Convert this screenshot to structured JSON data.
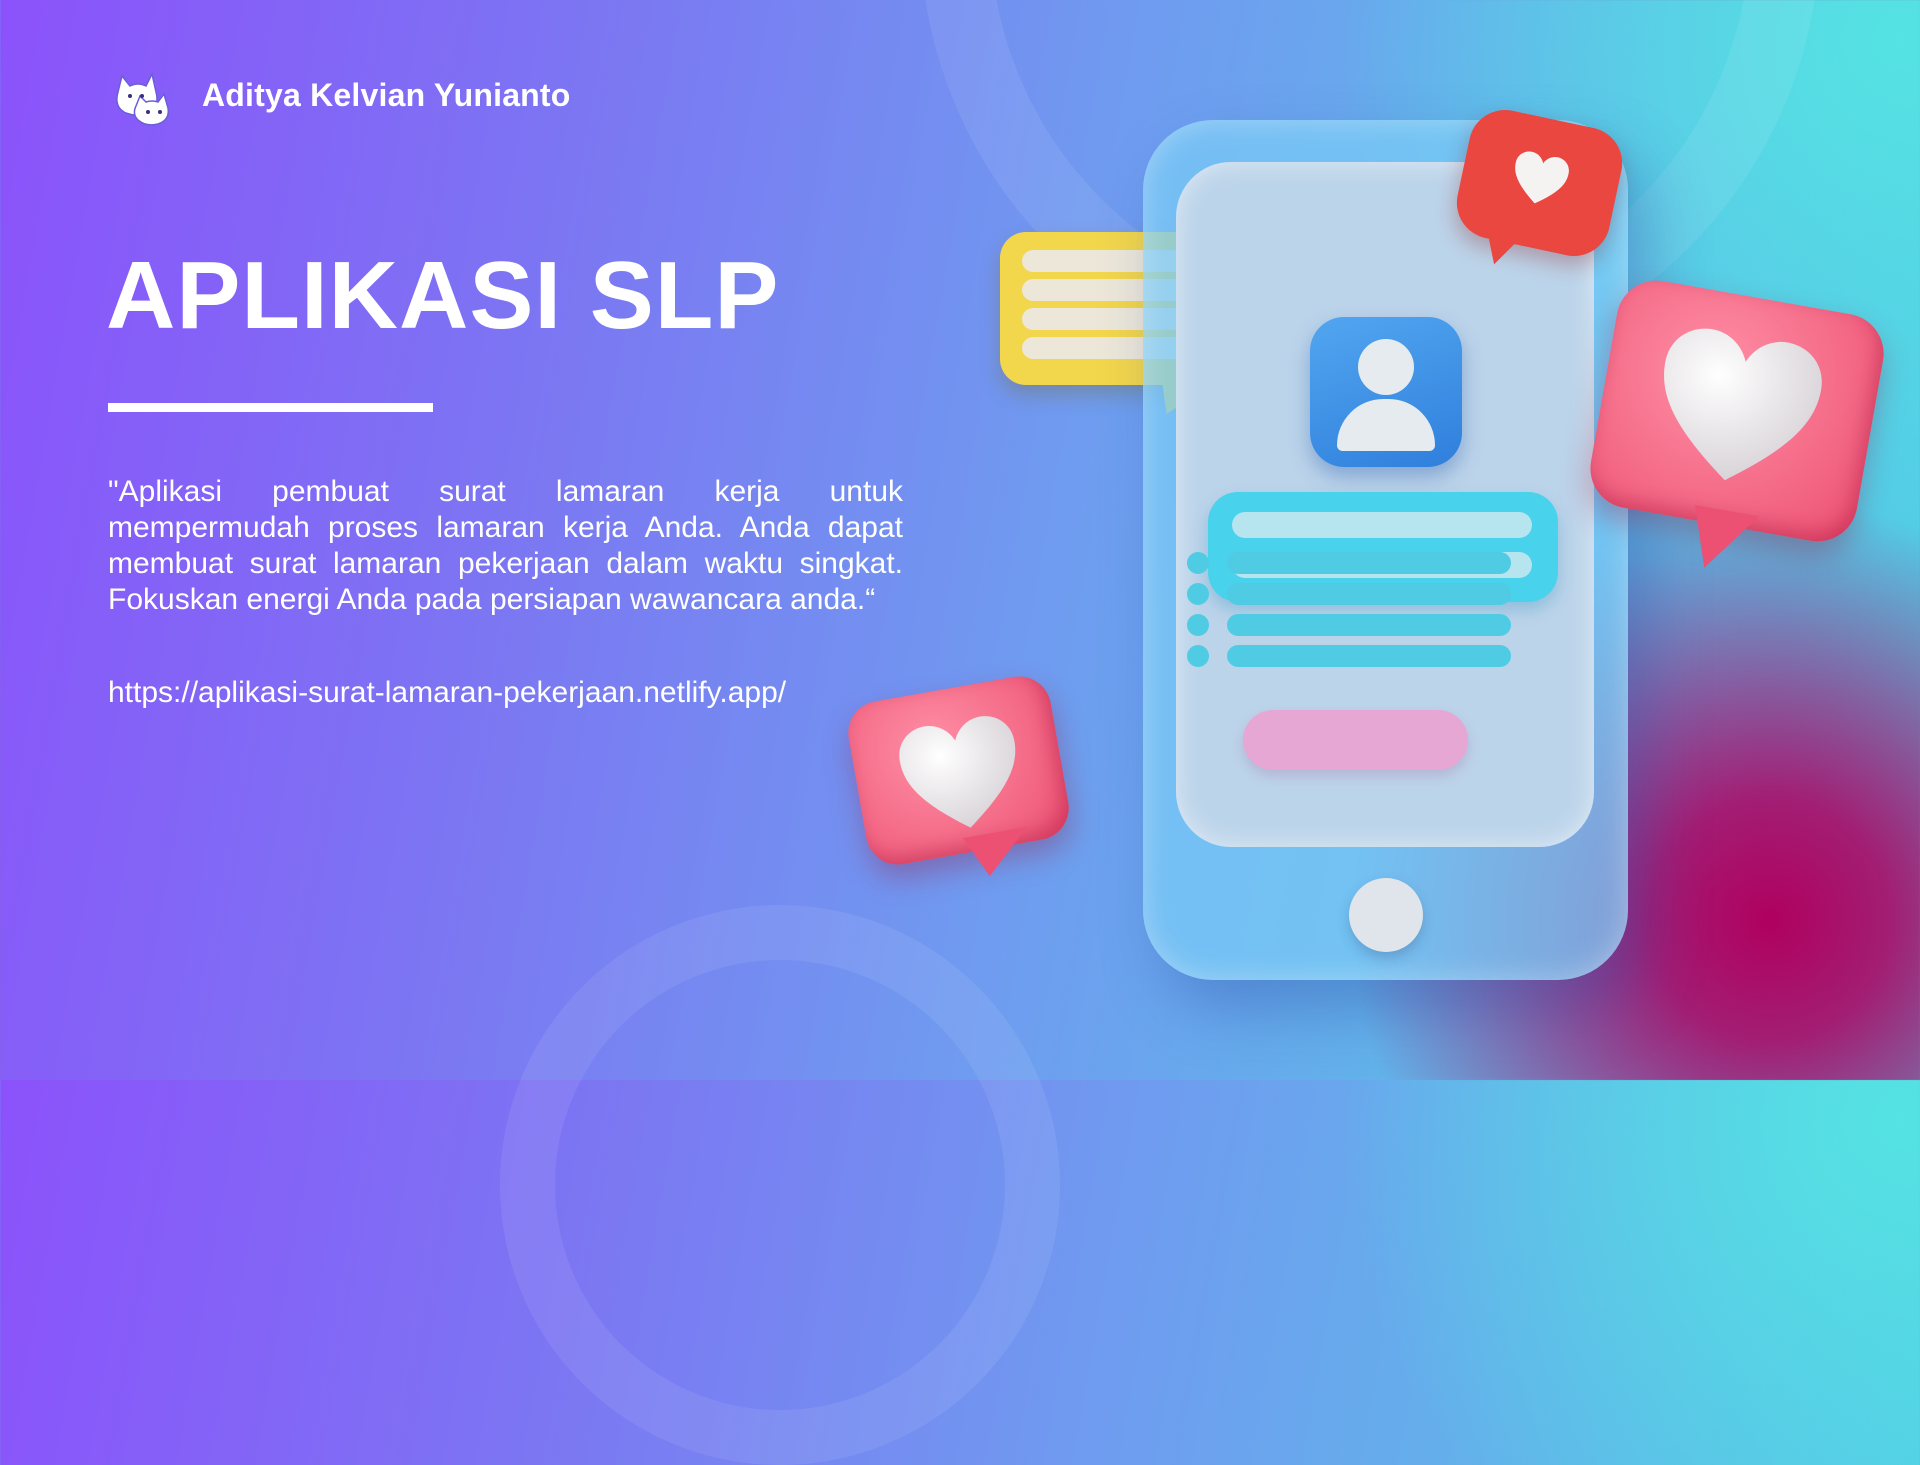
{
  "header": {
    "author_name": "Aditya Kelvian Yunianto",
    "logo_icon": "cat-mascot-logo"
  },
  "main": {
    "title": "APLIKASI SLP",
    "description": "\"Aplikasi pembuat surat lamaran kerja untuk mempermudah proses lamaran kerja Anda. Anda dapat membuat surat lamaran pekerjaan dalam waktu singkat. Fokuskan energi Anda pada persiapan wawancara anda.“",
    "url": "https://aplikasi-surat-lamaran-pekerjaan.netlify.app/"
  },
  "illustration": {
    "type": "phone-with-chat-bubbles-and-hearts",
    "icons": [
      "user-icon",
      "chat-bubble-icon",
      "heart-icon"
    ]
  },
  "colors": {
    "accent_red": "#e9473f",
    "accent_pink": "#ec5072",
    "accent_yellow": "#f2d64b",
    "accent_cyan": "#49d2ec",
    "avatar_blue": "#2f7fdc"
  }
}
